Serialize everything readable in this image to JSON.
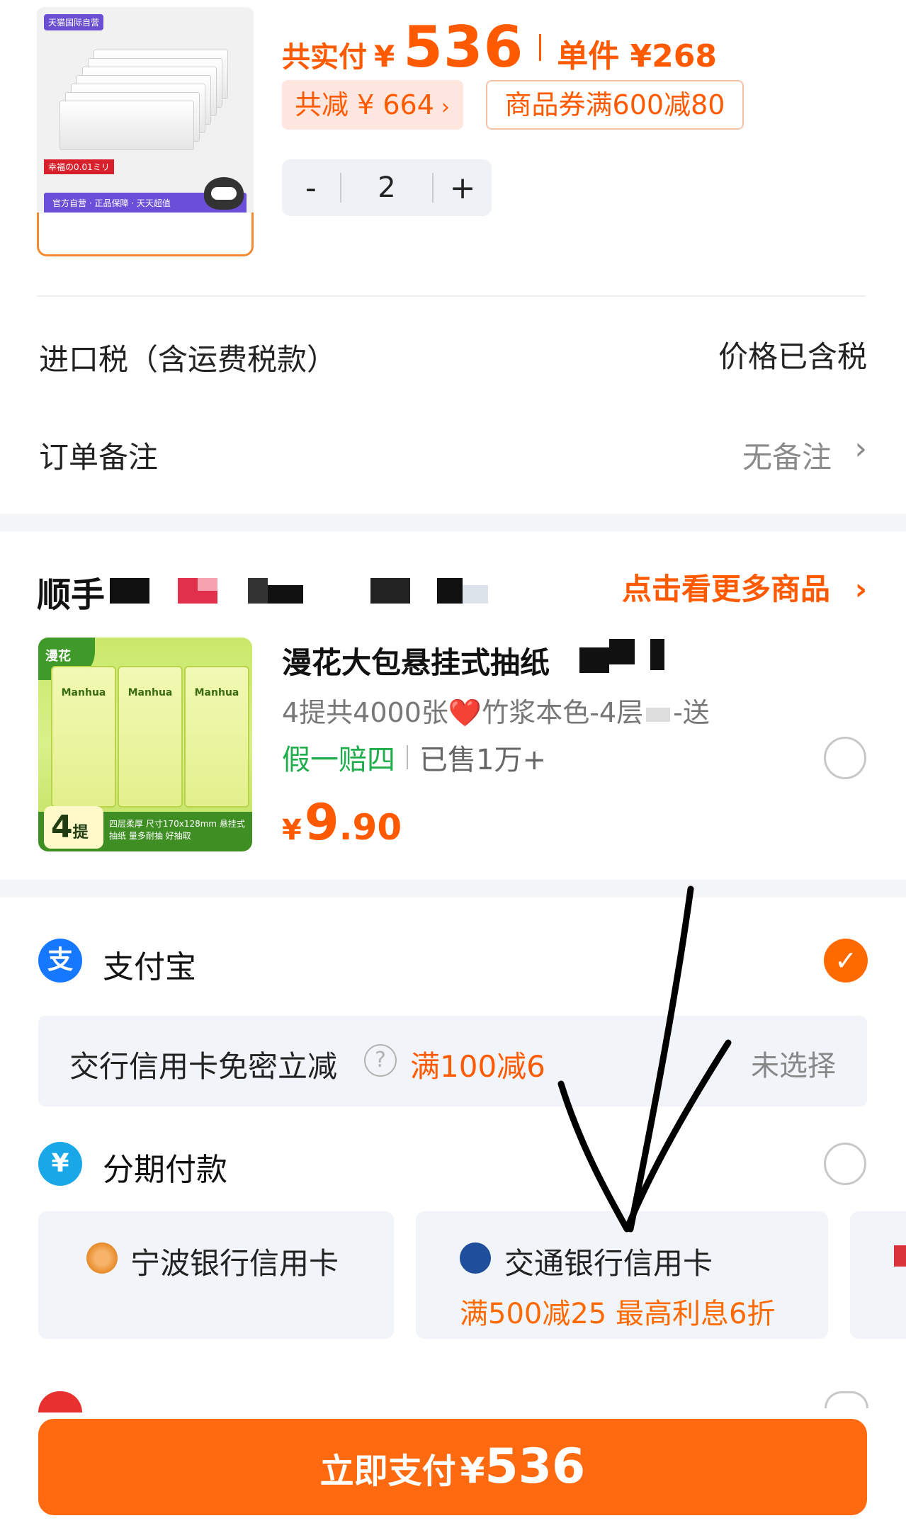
{
  "top_item": {
    "thumb_badge": "天猫国际自营",
    "thumb_brand": "幸福の0.01ミリ",
    "thumb_footer": "官方自营 · 正品保障 · 天天超值",
    "total_label": "共实付",
    "total_currency": "¥",
    "total_amount": "536",
    "unit_label": "单件 ¥268",
    "discount_label": "共减 ¥ 664",
    "coupon_label": "商品券满600减80",
    "qty_minus": "-",
    "qty_value": "2",
    "qty_plus": "+"
  },
  "order_rows": {
    "tax_label": "进口税（含运费税款）",
    "tax_value": "价格已含税",
    "note_label": "订单备注",
    "note_value": "无备注"
  },
  "shop": {
    "name": "顺手",
    "more_link": "点击看更多商品",
    "product": {
      "img_brand": "漫花",
      "img_pack_label": "Manhua",
      "img_bar_text": "四层柔厚 尺寸170x128mm 悬挂式抽纸 量多耐抽 好抽取",
      "img_count": "4",
      "img_count_unit": "提",
      "title": "漫花大包悬挂式抽纸",
      "subtitle": "4提共4000张❤️竹浆本色-4层",
      "subtitle_tail": "-送",
      "tag_guarantee": "假一赔四",
      "tag_sold": "已售1万+",
      "price_currency": "¥",
      "price_int": "9",
      "price_dec": ".90"
    }
  },
  "payment": {
    "alipay_label": "支付宝",
    "alipay_icon_char": "支",
    "promo_text": "交行信用卡免密立减",
    "promo_help": "?",
    "promo_deal": "满100减6",
    "promo_state": "未选择",
    "installment_label": "分期付款",
    "installment_icon_char": "¥",
    "cards": [
      {
        "bank": "宁波银行信用卡",
        "offer": ""
      },
      {
        "bank": "交通银行信用卡",
        "offer": "满500减25  最高利息6折"
      }
    ],
    "colors": {
      "accent": "#ff6a00",
      "alipay_blue": "#1677ff",
      "installment_teal": "#1aa7e8"
    }
  },
  "pay_button": {
    "label": "立即支付",
    "currency": "¥",
    "amount": "536"
  }
}
